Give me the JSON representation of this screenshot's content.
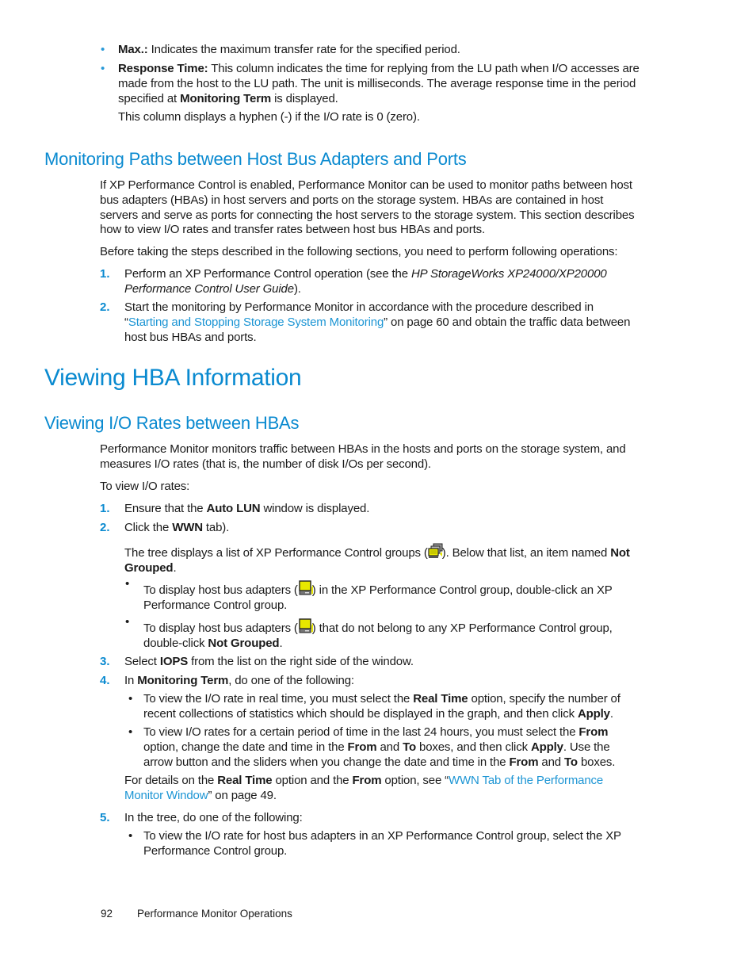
{
  "top_bullets": [
    {
      "term": "Max.:",
      "text": " Indicates the maximum transfer rate for the specified period."
    },
    {
      "term": "Response Time:",
      "text_1": " This column indicates the time for replying from the LU path when I/O accesses are made from the host to the LU path. The unit is milliseconds. The average response time in the period specified at ",
      "bold_1": "Monitoring Term",
      "text_2": " is displayed.",
      "note": "This column displays a hyphen (-) if the I/O rate is 0 (zero)."
    }
  ],
  "section_monitoring": {
    "heading": "Monitoring Paths between Host Bus Adapters and Ports",
    "para_1": "If XP Performance Control is enabled, Performance Monitor can be used to monitor paths between host bus adapters (HBAs) in host servers and ports on the storage system. HBAs are contained in host servers and serve as ports for connecting the host servers to the storage system. This section describes how to view I/O rates and transfer rates between host bus HBAs and ports.",
    "para_2": "Before taking the steps described in the following sections, you need to perform following operations:",
    "steps": [
      {
        "num": "1.",
        "text_1": "Perform an XP Performance Control operation (see the ",
        "italic": "HP StorageWorks XP24000/XP20000 Performance Control User Guide",
        "text_2": ")."
      },
      {
        "num": "2.",
        "text_1": "Start the monitoring by Performance Monitor in accordance with the procedure described in “",
        "link": "Starting and Stopping Storage System Monitoring",
        "text_2": "” on page 60 and obtain the traffic data between host bus HBAs and ports."
      }
    ]
  },
  "chapter_heading": "Viewing HBA Information",
  "section_io": {
    "heading": "Viewing I/O Rates between HBAs",
    "para_1": "Performance Monitor monitors traffic between HBAs in the hosts and ports on the storage system, and measures I/O rates (that is, the number of disk I/Os per second).",
    "para_2": "To view I/O rates:",
    "steps": [
      {
        "num": "1.",
        "text_1": "Ensure that the ",
        "bold": "Auto LUN",
        "text_2": " window is displayed."
      },
      {
        "num": "2.",
        "text_1": "Click the ",
        "bold": "WWN",
        "text_2": " tab).",
        "sub_1": "The tree displays a list of XP Performance Control groups (",
        "sub_2": "). Below that list, an item named ",
        "sub_bold": "Not Grouped",
        "sub_3": ".",
        "bullets": [
          {
            "text_1": "To display host bus adapters (",
            "text_2": ") in the XP Performance Control group, double-click an XP Performance Control group."
          },
          {
            "text_1": "To display host bus adapters (",
            "text_2": ") that do not belong to any XP Performance Control group, double-click ",
            "bold": "Not Grouped",
            "text_3": "."
          }
        ]
      },
      {
        "num": "3.",
        "text_1": "Select ",
        "bold": "IOPS",
        "text_2": " from the list on the right side of the window."
      },
      {
        "num": "4.",
        "text_1": "In ",
        "bold": "Monitoring Term",
        "text_2": ", do one of the following:",
        "bullets": [
          {
            "t1": "To view the I/O rate in real time, you must select the ",
            "b1": "Real Time",
            "t2": " option, specify the number of recent collections of statistics which should be displayed in the graph, and then click ",
            "b2": "Apply",
            "t3": "."
          },
          {
            "t1": "To view I/O rates for a certain period of time in the last 24 hours, you must select the ",
            "b1": "From",
            "t2": " option, change the date and time in the ",
            "b2": "From",
            "t3": " and ",
            "b3": "To",
            "t4": " boxes, and then click ",
            "b4": "Apply",
            "t5": ". Use the arrow button and the sliders when you change the date and time in the ",
            "b5": "From",
            "t6": " and ",
            "b6": "To",
            "t7": " boxes."
          }
        ],
        "details": {
          "t1": "For details on the ",
          "b1": "Real Time",
          "t2": " option and the ",
          "b2": "From",
          "t3": " option, see “",
          "link": "WWN Tab of the Performance Monitor Window",
          "t4": "” on page 49."
        }
      },
      {
        "num": "5.",
        "text": "In the tree, do one of the following:",
        "bullets": [
          {
            "text": "To view the I/O rate for host bus adapters in an XP Performance Control group, select the XP Performance Control group."
          }
        ]
      }
    ]
  },
  "icons": {
    "group": "pfc-group-icon",
    "hba": "host-bus-adapter-icon"
  },
  "footer": {
    "page_number": "92",
    "section": "Performance Monitor Operations"
  }
}
